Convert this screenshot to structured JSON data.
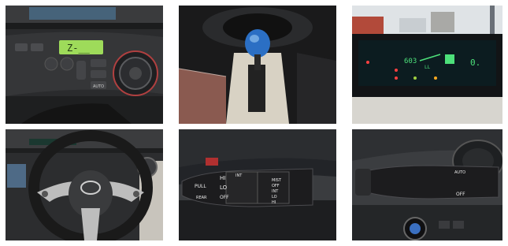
{
  "gallery": {
    "photos": [
      {
        "id": "p1",
        "subject": "climate-control-panel"
      },
      {
        "id": "p2",
        "subject": "hybrid-shift-knob"
      },
      {
        "id": "p3",
        "subject": "digital-dashboard"
      },
      {
        "id": "p4",
        "subject": "steering-wheel"
      },
      {
        "id": "p5",
        "subject": "wiper-stalk"
      },
      {
        "id": "p6",
        "subject": "light-stalk"
      }
    ]
  },
  "photo1": {
    "lcd_text": "Z-__",
    "auto_label": "AUTO"
  },
  "photo3": {
    "speed_text": "603",
    "trip_text": "0.",
    "readout_text": "LL"
  },
  "photo5": {
    "labels": [
      "PULL",
      "HI",
      "LO",
      "REAR",
      "OFF",
      "INT",
      "MIST",
      "OFF",
      "INT",
      "LO",
      "HI"
    ]
  },
  "photo6": {
    "labels": [
      "AUTO",
      "OFF"
    ]
  }
}
